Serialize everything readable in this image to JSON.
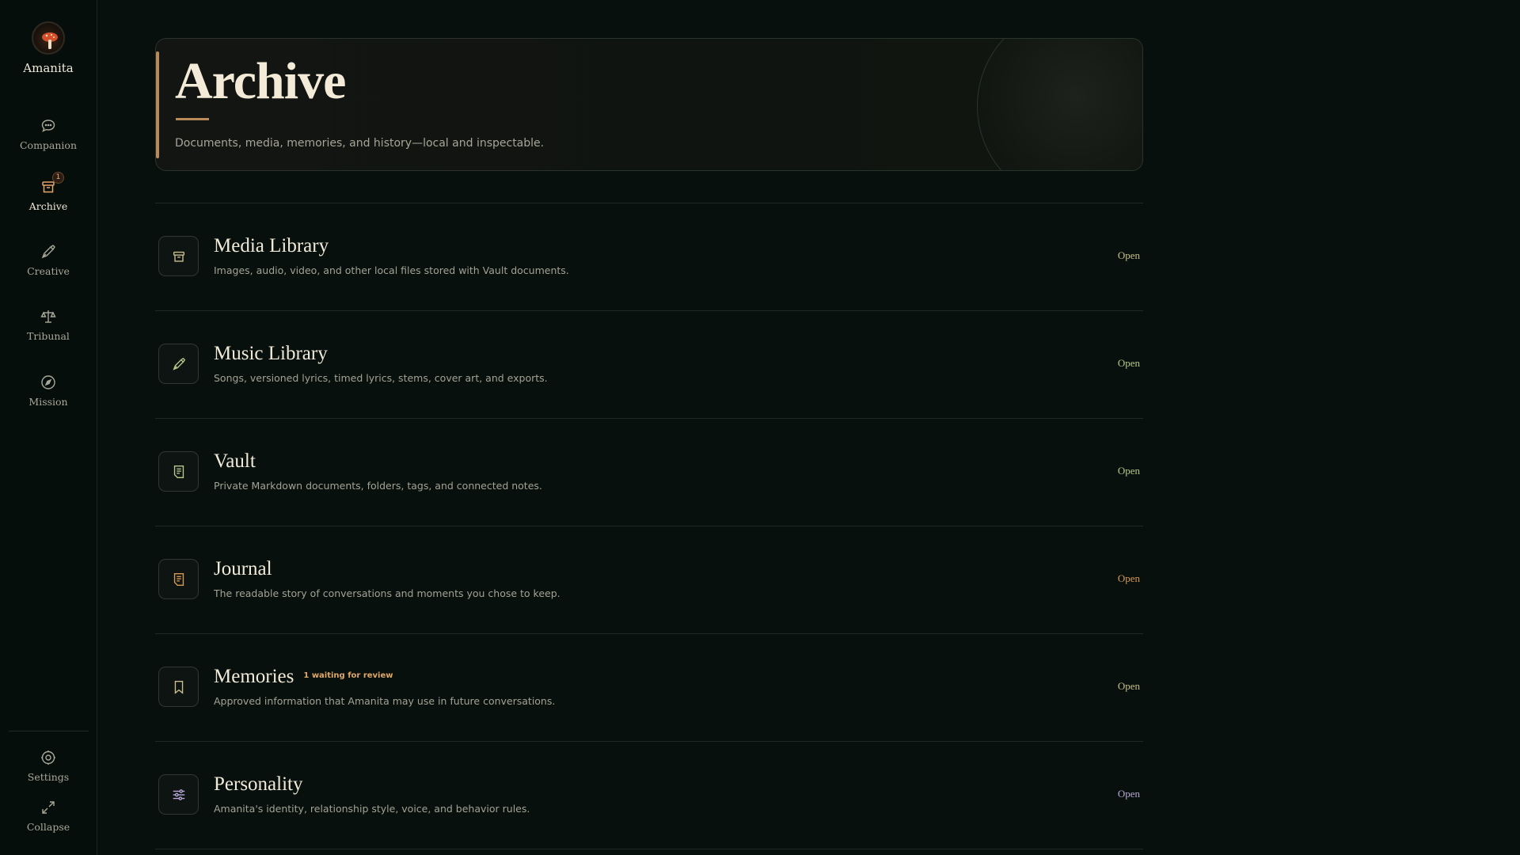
{
  "app": {
    "name": "Amanita"
  },
  "sidebar": {
    "items": [
      {
        "label": "Companion",
        "icon": "chat-bubble-icon"
      },
      {
        "label": "Archive",
        "icon": "archive-box-icon",
        "badge": "1",
        "active": true
      },
      {
        "label": "Creative",
        "icon": "pen-nib-icon"
      },
      {
        "label": "Tribunal",
        "icon": "scales-icon"
      },
      {
        "label": "Mission",
        "icon": "compass-icon"
      }
    ],
    "footer": [
      {
        "label": "Settings",
        "icon": "gear-icon"
      },
      {
        "label": "Collapse",
        "icon": "collapse-arrow-icon"
      }
    ]
  },
  "header": {
    "title": "Archive",
    "subtitle": "Documents, media, memories, and history—local and inspectable."
  },
  "sections": [
    {
      "title": "Media Library",
      "description": "Images, audio, video, and other local files stored with Vault documents.",
      "action": "Open",
      "icon": "archive-box-icon",
      "color": "#cbbf8f"
    },
    {
      "title": "Music Library",
      "description": "Songs, versioned lyrics, timed lyrics, stems, cover art, and exports.",
      "action": "Open",
      "icon": "pen-nib-icon",
      "color": "#b7c98c"
    },
    {
      "title": "Vault",
      "description": "Private Markdown documents, folders, tags, and connected notes.",
      "action": "Open",
      "icon": "document-icon",
      "color": "#b7c98c"
    },
    {
      "title": "Journal",
      "description": "The readable story of conversations and moments you chose to keep.",
      "action": "Open",
      "icon": "journal-icon",
      "color": "#d79a55"
    },
    {
      "title": "Memories",
      "badge": "1 waiting for review",
      "description": "Approved information that Amanita may use in future conversations.",
      "action": "Open",
      "icon": "bookmark-icon",
      "color": "#cbbf8f"
    },
    {
      "title": "Personality",
      "description": "Amanita's identity, relationship style, voice, and behavior rules.",
      "action": "Open",
      "icon": "sliders-icon",
      "color": "#b9a8d8"
    }
  ]
}
